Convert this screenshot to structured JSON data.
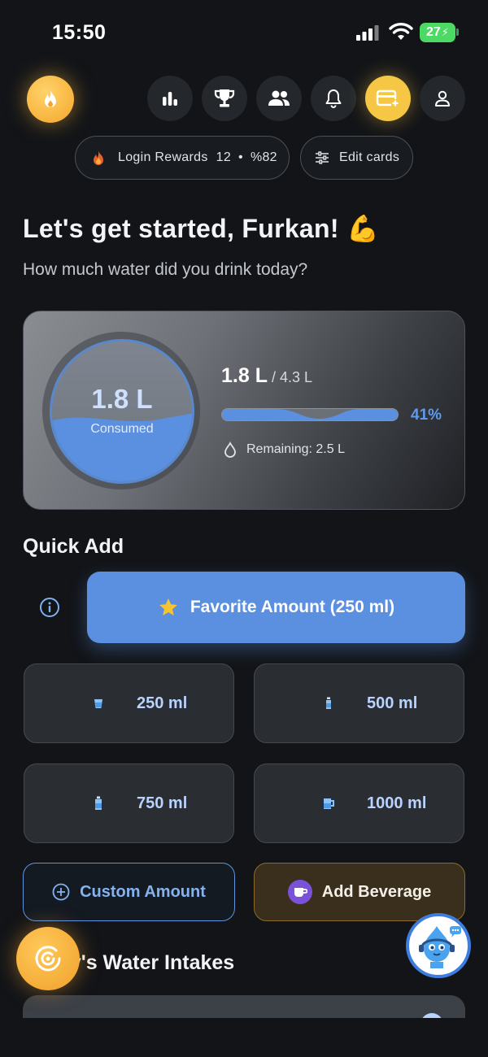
{
  "status_bar": {
    "time": "15:50",
    "battery": "27"
  },
  "nav": {
    "streak_icon": "flame-icon",
    "buttons": [
      "stats-icon",
      "trophy-icon",
      "friends-icon",
      "bell-icon",
      "card-add-icon",
      "profile-icon"
    ],
    "active": "card-add-icon"
  },
  "pills": {
    "login_rewards_label": "Login Rewards",
    "login_rewards_count": "12",
    "login_rewards_percent": "%82",
    "edit_cards_label": "Edit cards"
  },
  "greeting": {
    "title": "Let's get started, Furkan! 💪",
    "subtitle": "How much water did you drink today?"
  },
  "progress": {
    "consumed_value": "1.8 L",
    "consumed_label": "Consumed",
    "amount": "1.8 L",
    "goal": " / 4.3 L",
    "percent_text": "41%",
    "fraction": 0.41,
    "remaining": "Remaining: 2.5 L"
  },
  "quick_add": {
    "title": "Quick Add",
    "favorite_label": "Favorite Amount (250 ml)",
    "amounts": [
      {
        "label": "250 ml",
        "icon": "glass-icon"
      },
      {
        "label": "500 ml",
        "icon": "small-bottle-icon"
      },
      {
        "label": "750 ml",
        "icon": "bottle-icon"
      },
      {
        "label": "1000 ml",
        "icon": "jug-icon"
      }
    ],
    "custom_label": "Custom Amount",
    "beverage_label": "Add Beverage"
  },
  "intakes": {
    "title": "Today's Water Intakes"
  },
  "colors": {
    "accent_blue": "#5b8fdf",
    "gold": "#f6c645",
    "background": "#121418"
  }
}
